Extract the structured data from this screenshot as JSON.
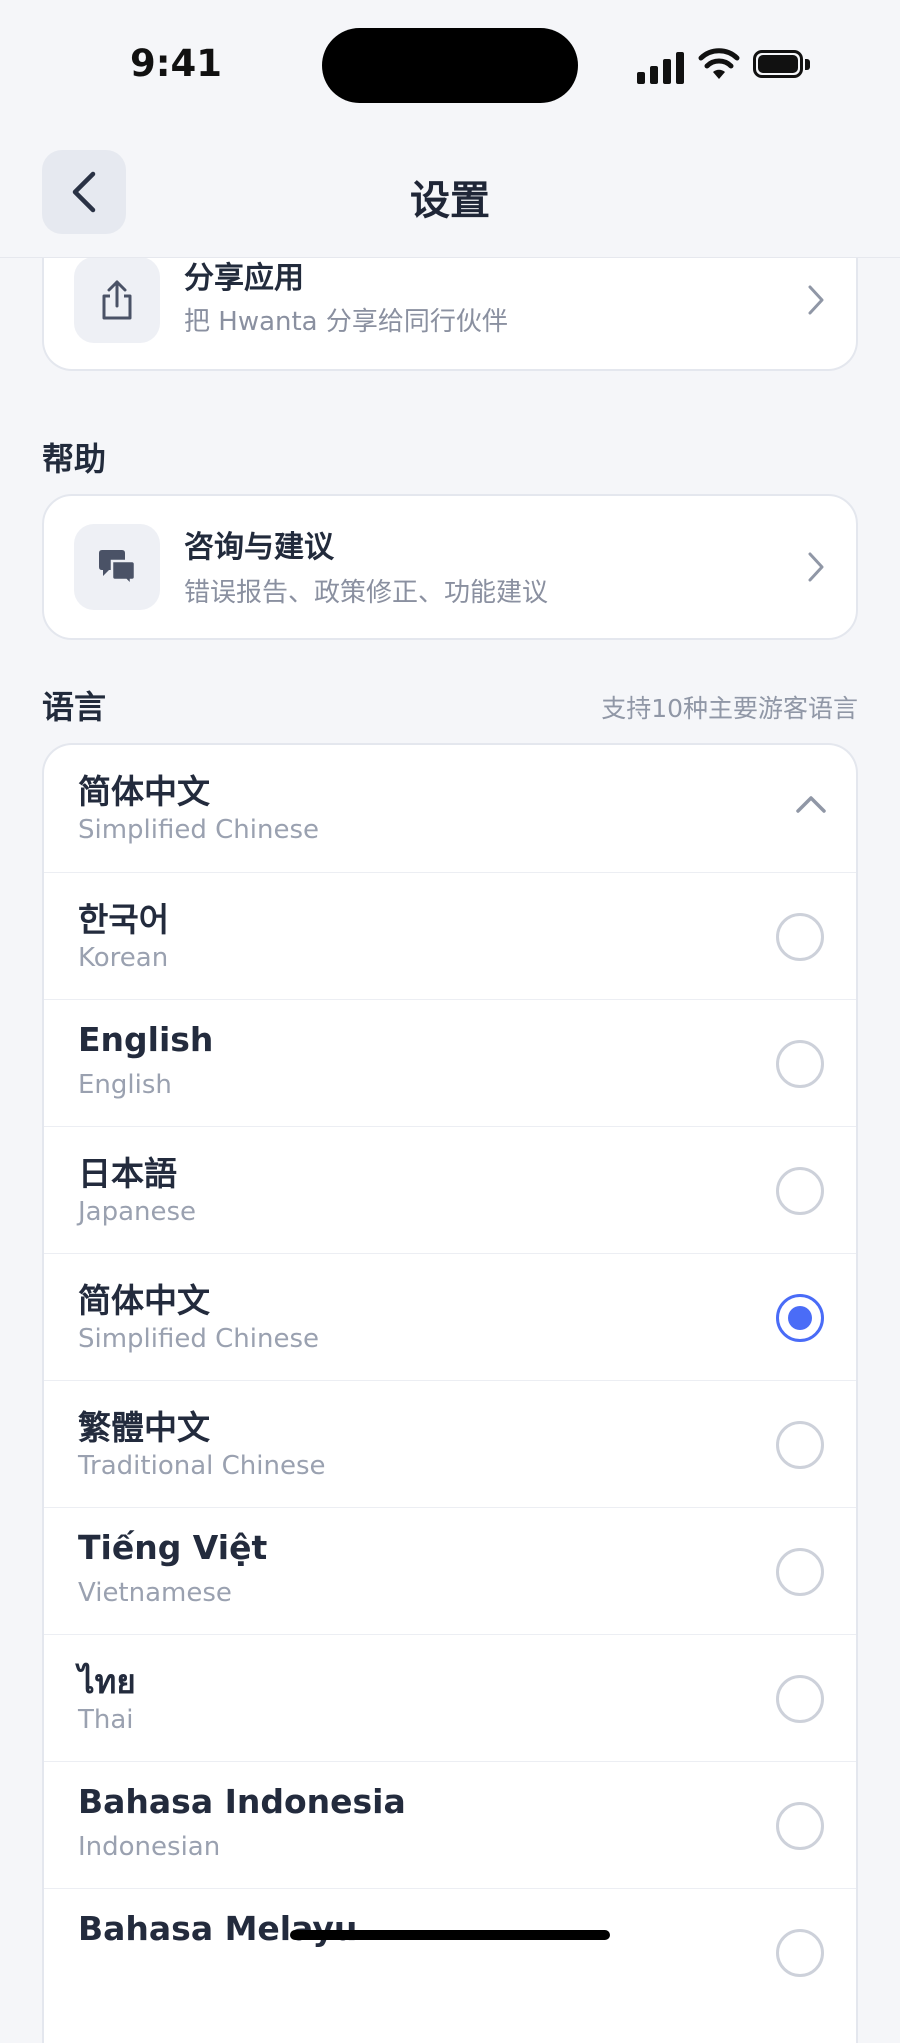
{
  "status": {
    "time": "9:41"
  },
  "header": {
    "title": "设置"
  },
  "share": {
    "title": "分享应用",
    "subtitle": "把 Hwanta 分享给同行伙伴"
  },
  "help": {
    "section_title": "帮助",
    "title": "咨询与建议",
    "subtitle": "错误报告、政策修正、功能建议"
  },
  "language": {
    "section_title": "语言",
    "note": "支持10种主要游客语言",
    "current": {
      "name": "简体中文",
      "sub": "Simplified Chinese"
    },
    "options": [
      {
        "name": "한국어",
        "sub": "Korean",
        "selected": false
      },
      {
        "name": "English",
        "sub": "English",
        "selected": false
      },
      {
        "name": "日本語",
        "sub": "Japanese",
        "selected": false
      },
      {
        "name": "简体中文",
        "sub": "Simplified Chinese",
        "selected": true
      },
      {
        "name": "繁體中文",
        "sub": "Traditional Chinese",
        "selected": false
      },
      {
        "name": "Tiếng Việt",
        "sub": "Vietnamese",
        "selected": false
      },
      {
        "name": "ไทย",
        "sub": "Thai",
        "selected": false
      },
      {
        "name": "Bahasa Indonesia",
        "sub": "Indonesian",
        "selected": false
      },
      {
        "name": "Bahasa Melayu",
        "sub": "",
        "selected": false
      }
    ]
  },
  "colors": {
    "accent": "#4a6cf7",
    "background": "#f5f6f9",
    "text": "#222b3c",
    "muted": "#9aa1b0"
  }
}
